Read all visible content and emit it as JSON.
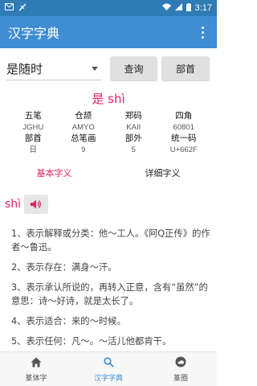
{
  "status_bar": {
    "time": "3:17",
    "left_icons": [
      "mail-icon",
      "signal-slash-icon"
    ],
    "right_icons": [
      "wifi-icon",
      "cell-signal-icon",
      "battery-icon"
    ]
  },
  "app_bar": {
    "title": "汉字字典",
    "menu_icon": "more-vert-icon"
  },
  "query": {
    "select_value": "是随时",
    "query_button": "查询",
    "radical_button": "部首"
  },
  "character": {
    "header": "是 shì"
  },
  "info": {
    "labels_row1": [
      "五笔",
      "仓颉",
      "郑码",
      "四角"
    ],
    "values_row1": [
      "JGHU",
      "AMYO",
      "KAII",
      "60801"
    ],
    "labels_row2": [
      "部首",
      "总笔画",
      "部外",
      "统一码"
    ],
    "values_row2": [
      "日",
      "9",
      "5",
      "U+662F"
    ]
  },
  "tabs": {
    "basic": "基本字义",
    "detailed": "详细字义"
  },
  "pinyin": {
    "text": "shì",
    "speaker_icon": "speaker-icon"
  },
  "definitions": [
    "1、表示解释或分类：他～工人。《阿Q正传》的作者～鲁迅。",
    "2、表示存在：满身～汗。",
    "3、表示承认所说的，再转入正意，含有“虽然”的意思：诗～好诗，就是太长了。",
    "4、表示适合：来的～时候。",
    "5、表示任何：凡～。～活儿他都肯干。"
  ],
  "bottom_nav": [
    {
      "label": "篆体字",
      "icon": "home-icon"
    },
    {
      "label": "汉字字典",
      "icon": "search-icon"
    },
    {
      "label": "篆圈",
      "icon": "cloud-icon"
    }
  ],
  "colors": {
    "status_bar": "#2f7bb6",
    "app_bar": "#3f8dd3",
    "accent": "#e91e63"
  }
}
